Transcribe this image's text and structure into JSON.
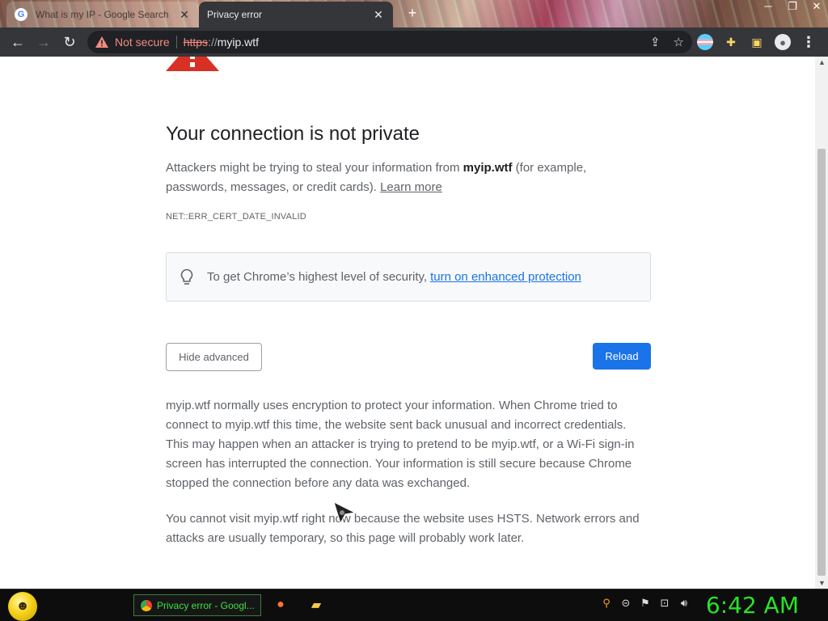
{
  "browser": {
    "tabs": [
      {
        "title": "What is my IP - Google Search",
        "active": false,
        "icon": "google-icon"
      },
      {
        "title": "Privacy error",
        "active": true,
        "icon": "warning-icon"
      }
    ],
    "new_tab_label": "+",
    "window_controls": [
      "─",
      "❐",
      "✕"
    ],
    "toolbar": {
      "security_label": "Not secure",
      "url_scheme": "https",
      "url_slashes": "://",
      "url_host": "myip.wtf"
    }
  },
  "page": {
    "headline": "Your connection is not private",
    "explanation_prefix": "Attackers might be trying to steal your information from ",
    "explanation_host": "myip.wtf",
    "explanation_suffix": " (for example, passwords, messages, or credit cards). ",
    "learn_more": "Learn more",
    "error_code": "NET::ERR_CERT_DATE_INVALID",
    "enhanced_text": "To get Chrome’s highest level of security,",
    "enhanced_link": "turn on enhanced protection",
    "hide_advanced": "Hide advanced",
    "reload": "Reload",
    "details_1": "myip.wtf normally uses encryption to protect your information. When Chrome tried to connect to myip.wtf this time, the website sent back unusual and incorrect credentials. This may happen when an attacker is trying to pretend to be myip.wtf, or a Wi-Fi sign-in screen has interrupted the connection. Your information is still secure because Chrome stopped the connection before any data was exchanged.",
    "details_2": "You cannot visit myip.wtf right now because the website uses HSTS. Network errors and attacks are usually temporary, so this page will probably work later."
  },
  "taskbar": {
    "active_window": "Privacy error - Googl...",
    "clock": "6:42 AM"
  },
  "colors": {
    "accent_blue": "#1a73e8",
    "warning_red": "#d93025",
    "clock_green": "#29e329"
  }
}
